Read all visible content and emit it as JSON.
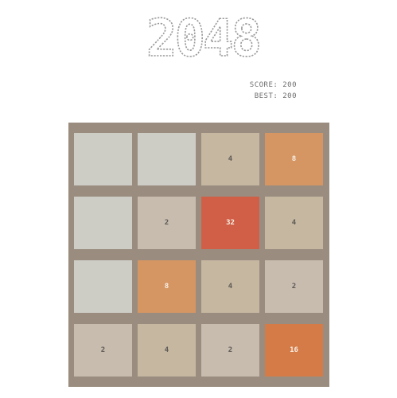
{
  "title": "2048",
  "score": {
    "label": "SCORE:",
    "value": "200"
  },
  "best": {
    "label": "BEST:",
    "value": "200"
  },
  "board": {
    "rows": [
      [
        "",
        "",
        "4",
        "8"
      ],
      [
        "",
        "2",
        "32",
        "4"
      ],
      [
        "",
        "8",
        "4",
        "2"
      ],
      [
        "2",
        "4",
        "2",
        "16"
      ]
    ]
  },
  "colors": {
    "board": "#9a8d7f",
    "empty": "#cdcdc6",
    "2": "#c8bcaf",
    "4": "#c6b7a1",
    "8": "#d59664",
    "16": "#d47b47",
    "32": "#d15f48"
  }
}
